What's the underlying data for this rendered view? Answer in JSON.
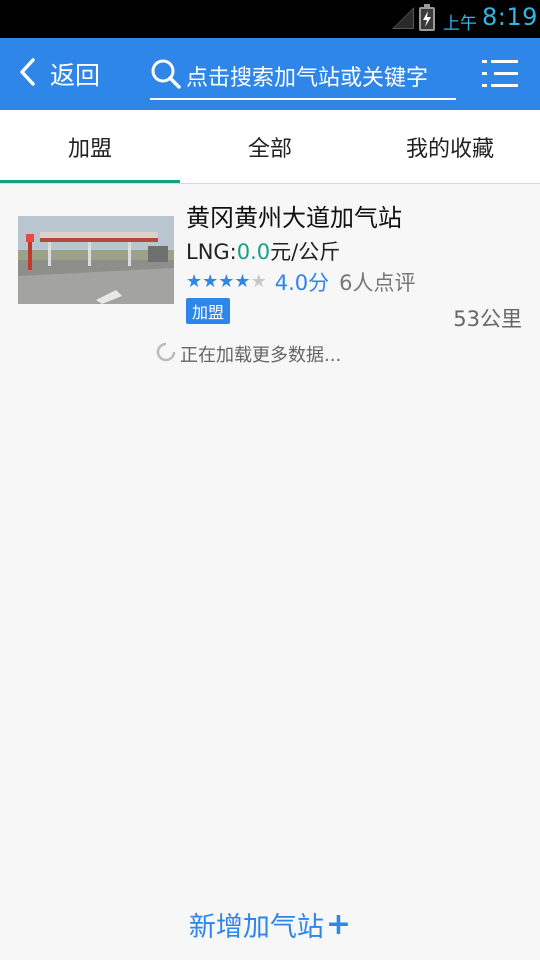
{
  "status_bar": {
    "ampm": "上午",
    "time": "8:19"
  },
  "header": {
    "back_label": "返回",
    "search_placeholder": "点击搜索加气站或关键字"
  },
  "tabs": [
    {
      "label": "加盟",
      "active": true
    },
    {
      "label": "全部",
      "active": false
    },
    {
      "label": "我的收藏",
      "active": false
    }
  ],
  "stations": [
    {
      "name": "黄冈黄州大道加气站",
      "fuel_label": "LNG:",
      "price": "0.0",
      "unit": "元/公斤",
      "stars_filled": 4,
      "stars_total": 5,
      "score": "4.0分",
      "reviews": "6人点评",
      "badge": "加盟",
      "distance": "53公里"
    }
  ],
  "loading_text": "正在加载更多数据...",
  "add_station_label": "新增加气站",
  "add_station_plus": "+",
  "colors": {
    "accent_blue": "#2e86e8",
    "accent_teal": "#16a085"
  }
}
